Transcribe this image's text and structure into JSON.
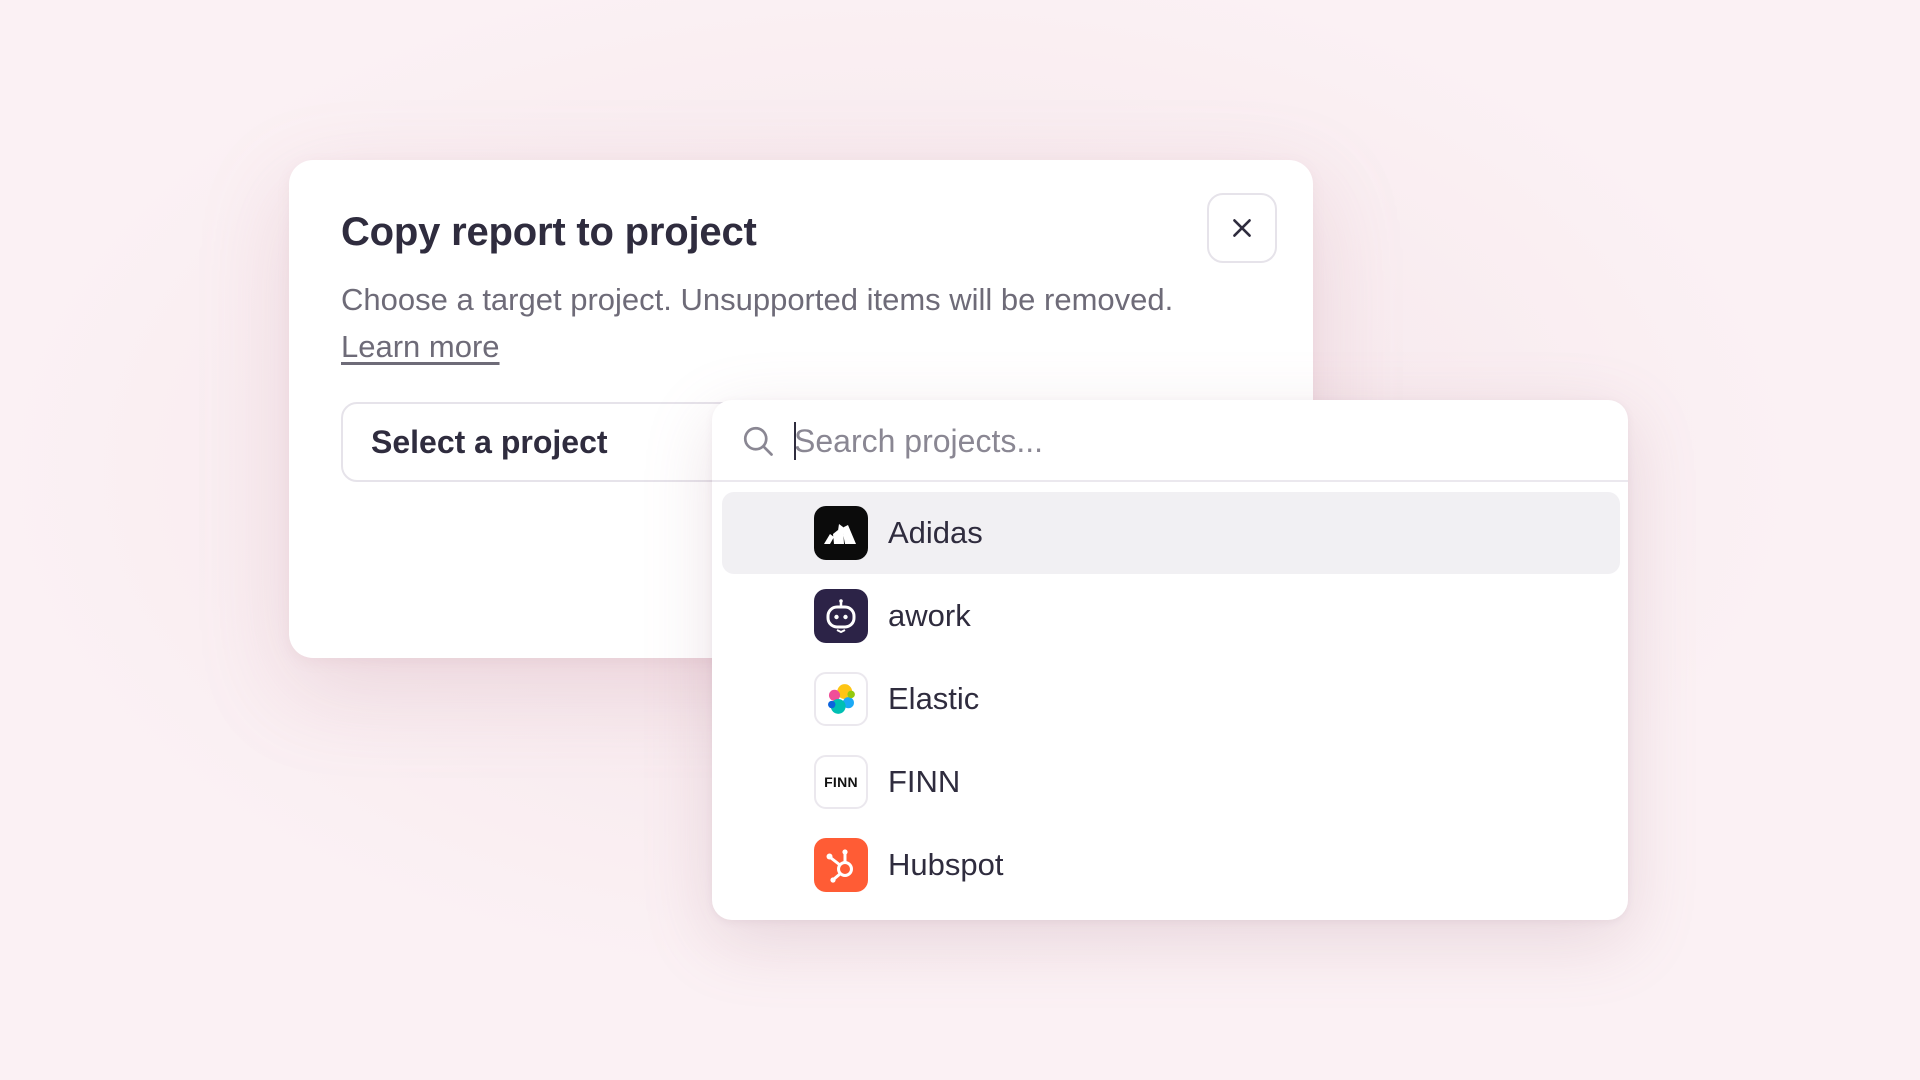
{
  "modal": {
    "title": "Copy report to project",
    "description": "Choose a target project. Unsupported items will be removed.",
    "learn_more": "Learn more",
    "close_icon": "close-icon",
    "select_placeholder": "Select a project"
  },
  "dropdown": {
    "search_placeholder": "Search projects...",
    "search_value": "",
    "search_icon": "search-icon",
    "projects": [
      {
        "label": "Adidas",
        "logo": "adidas-logo",
        "highlighted": true
      },
      {
        "label": "awork",
        "logo": "awork-logo",
        "highlighted": false
      },
      {
        "label": "Elastic",
        "logo": "elastic-logo",
        "highlighted": false
      },
      {
        "label": "FINN",
        "logo": "finn-logo",
        "logo_text": "FINN",
        "highlighted": false
      },
      {
        "label": "Hubspot",
        "logo": "hubspot-logo",
        "highlighted": false
      }
    ]
  },
  "colors": {
    "text_primary": "#2f2c3e",
    "text_secondary": "#6e6b78",
    "highlight_bg": "#f1f0f3",
    "awork_purple": "#2c2347",
    "hubspot_orange": "#ff5c35"
  }
}
